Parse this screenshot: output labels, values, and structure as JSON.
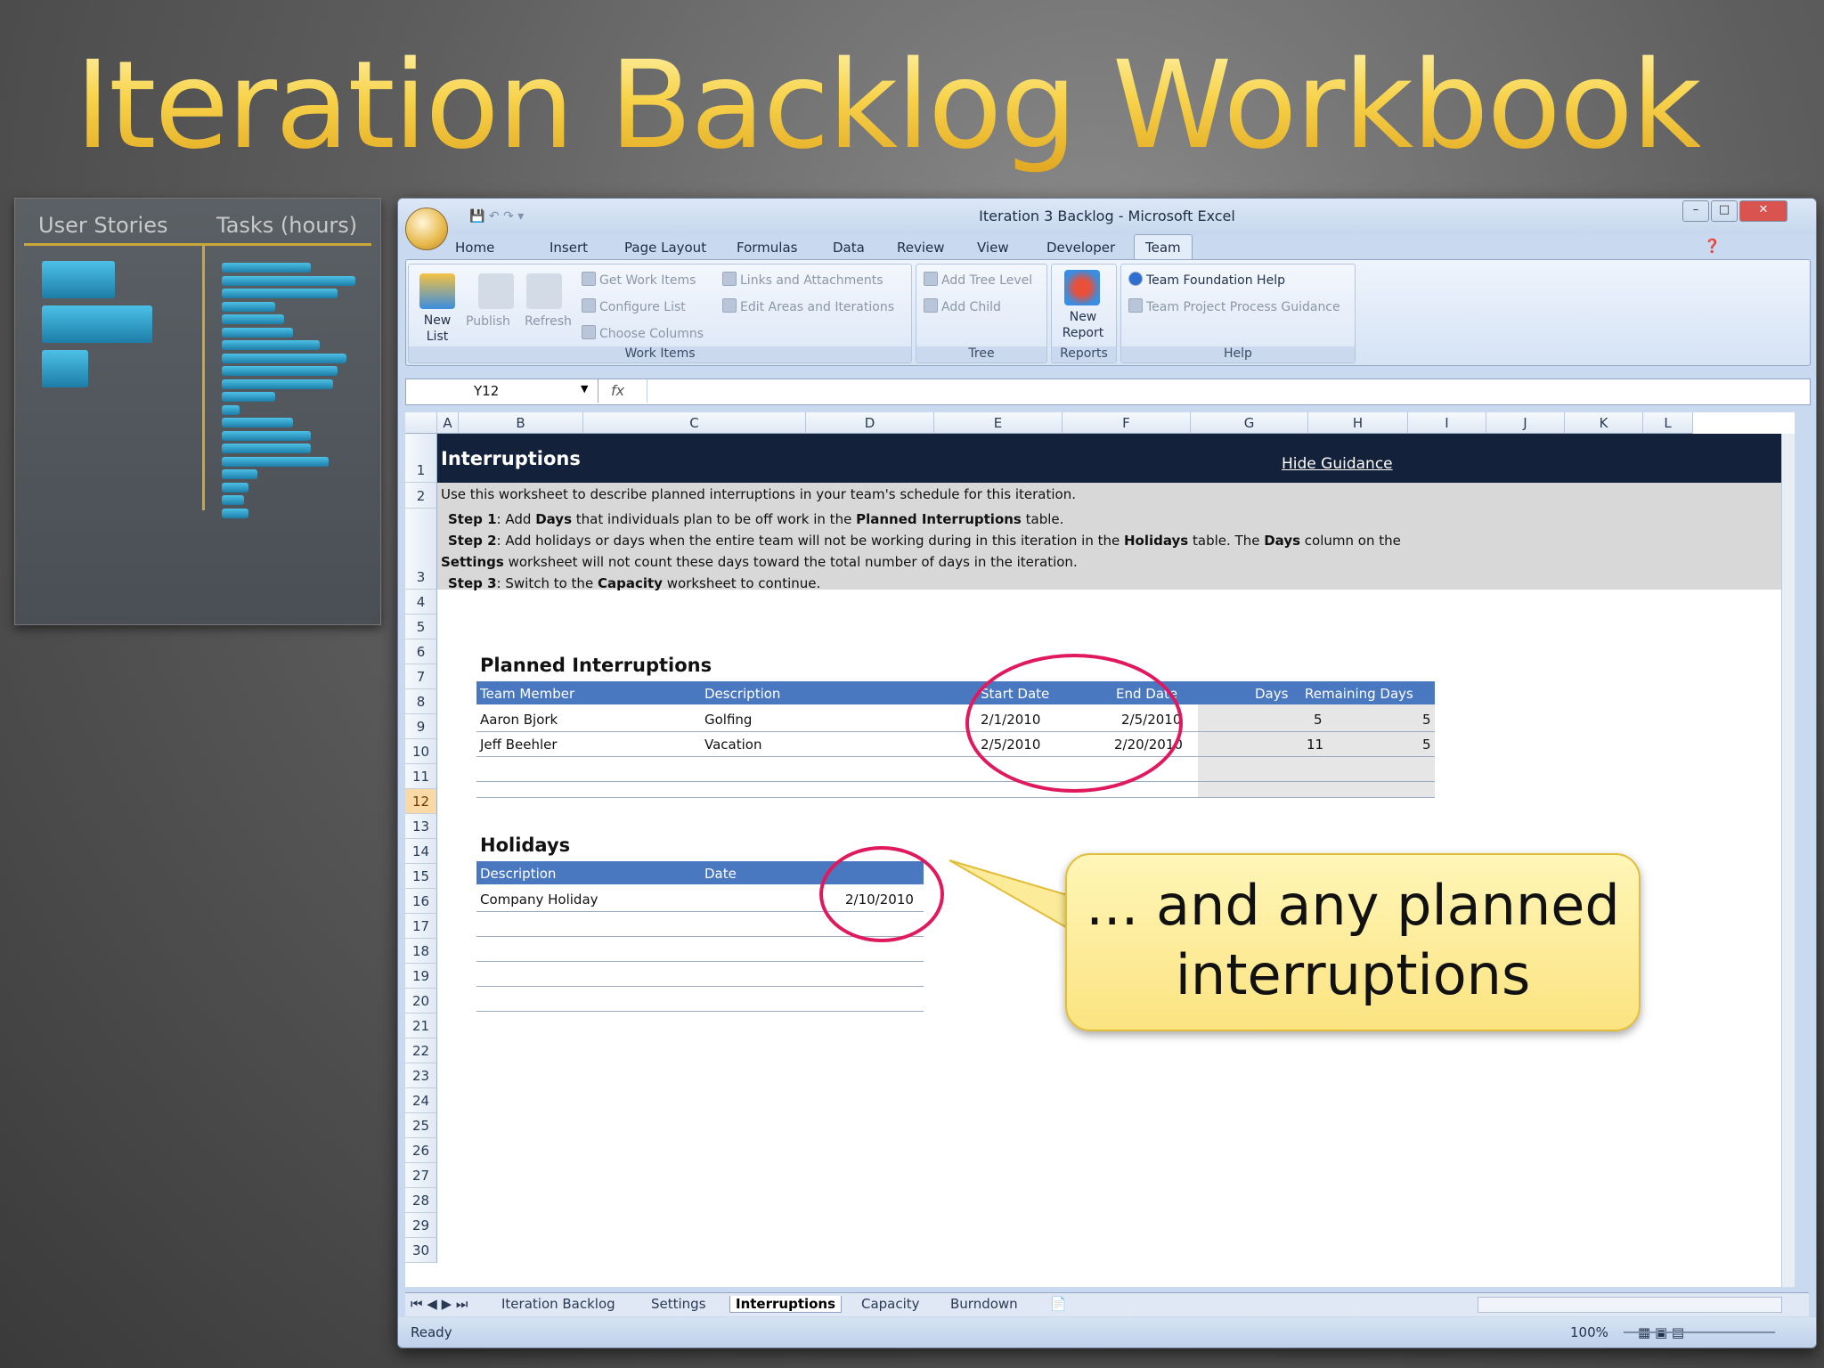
{
  "slide": {
    "title": "Iteration Backlog Workbook",
    "callout": "... and any planned interruptions"
  },
  "mini_chart": {
    "col1": "User Stories",
    "col2": "Tasks (hours)"
  },
  "window": {
    "title": "Iteration 3 Backlog - Microsoft Excel",
    "tabs": [
      "Home",
      "Insert",
      "Page Layout",
      "Formulas",
      "Data",
      "Review",
      "View",
      "Developer",
      "Team"
    ],
    "active_tab": "Team"
  },
  "ribbon": {
    "new_list": "New List",
    "publish": "Publish",
    "refresh": "Refresh",
    "get_work_items": "Get Work Items",
    "configure_list": "Configure List",
    "choose_columns": "Choose Columns",
    "links_attachments": "Links and Attachments",
    "edit_areas": "Edit Areas and Iterations",
    "group_work_items": "Work Items",
    "add_tree_level": "Add Tree Level",
    "add_child": "Add Child",
    "group_tree": "Tree",
    "new_report": "New Report",
    "group_reports": "Reports",
    "tf_help": "Team Foundation Help",
    "process_guidance": "Team Project Process Guidance",
    "group_help": "Help"
  },
  "formula_bar": {
    "name_box": "Y12",
    "fx": "fx"
  },
  "columns": [
    "A",
    "B",
    "C",
    "D",
    "E",
    "F",
    "G",
    "H",
    "I",
    "J",
    "K",
    "L"
  ],
  "rows": [
    "1",
    "2",
    "3",
    "4",
    "5",
    "6",
    "7",
    "8",
    "9",
    "10",
    "11",
    "12",
    "13",
    "14",
    "15",
    "16",
    "17",
    "18",
    "19",
    "20",
    "21",
    "22",
    "23",
    "24",
    "25",
    "26",
    "27",
    "28",
    "29",
    "30"
  ],
  "sheet": {
    "header": "Interruptions",
    "hide_guidance": "Hide Guidance",
    "intro": "Use this worksheet to describe planned interruptions in your team's schedule for this iteration.",
    "step1_label": "Step 1",
    "step1_a": ": Add ",
    "step1_b": "Days",
    "step1_c": " that individuals plan to be off work in the ",
    "step1_d": "Planned Interruptions",
    "step1_e": " table.",
    "step2_label": "Step 2",
    "step2_a": ": Add holidays or days when the entire team will not be working during in this iteration in the ",
    "step2_b": "Holidays",
    "step2_c": " table.  The ",
    "step2_d": "Days",
    "step2_e": " column on the",
    "step2_f": "Settings",
    "step2_g": " worksheet will not count these days toward the total number of days in the iteration.",
    "step3_label": "Step 3",
    "step3_a": ":  Switch to the ",
    "step3_b": "Capacity",
    "step3_c": " worksheet to continue.",
    "planned_title": "Planned Interruptions",
    "planned_headers": [
      "Team Member",
      "Description",
      "Start Date",
      "End Date",
      "Days",
      "Remaining Days"
    ],
    "planned_rows": [
      [
        "Aaron Bjork",
        "Golfing",
        "2/1/2010",
        "2/5/2010",
        "5",
        "5"
      ],
      [
        "Jeff Beehler",
        "Vacation",
        "2/5/2010",
        "2/20/2010",
        "11",
        "5"
      ]
    ],
    "holidays_title": "Holidays",
    "holidays_headers": [
      "Description",
      "Date"
    ],
    "holidays_rows": [
      [
        "Company Holiday",
        "2/10/2010"
      ]
    ]
  },
  "sheet_tabs": [
    "Iteration Backlog",
    "Settings",
    "Interruptions",
    "Capacity",
    "Burndown"
  ],
  "active_sheet": "Interruptions",
  "status": {
    "ready": "Ready",
    "zoom": "100%"
  }
}
